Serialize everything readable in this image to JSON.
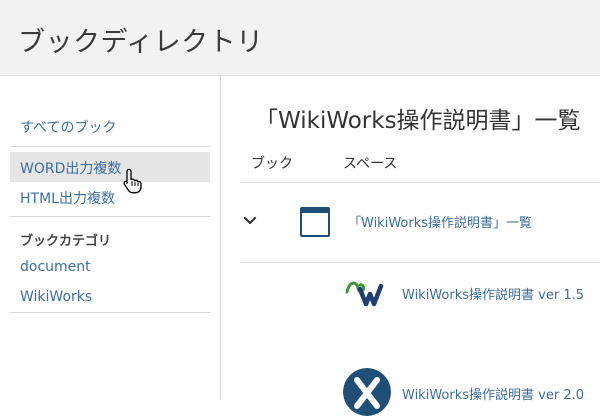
{
  "header": {
    "title": "ブックディレクトリ"
  },
  "sidebar": {
    "all_books": "すべてのブック",
    "word_export": "WORD出力複数",
    "html_export": "HTML出力複数",
    "category_heading": "ブックカテゴリ",
    "categories": [
      "document",
      "WikiWorks"
    ]
  },
  "main": {
    "title": "「WikiWorks操作説明書」一覧",
    "columns": [
      "ブック",
      "スペース"
    ],
    "parent_item": "「WikiWorks操作説明書」一覧",
    "children": [
      {
        "label": "WikiWorks操作説明書 ver 1.5",
        "logo": "wikiworks-logo-icon"
      },
      {
        "label": "WikiWorks操作説明書 ver 2.0",
        "logo": "xwiki-logo-icon"
      }
    ]
  },
  "colors": {
    "link": "#3c6ea0",
    "book_icon": "#1f4e79",
    "header_bg": "#f2f2f2"
  }
}
